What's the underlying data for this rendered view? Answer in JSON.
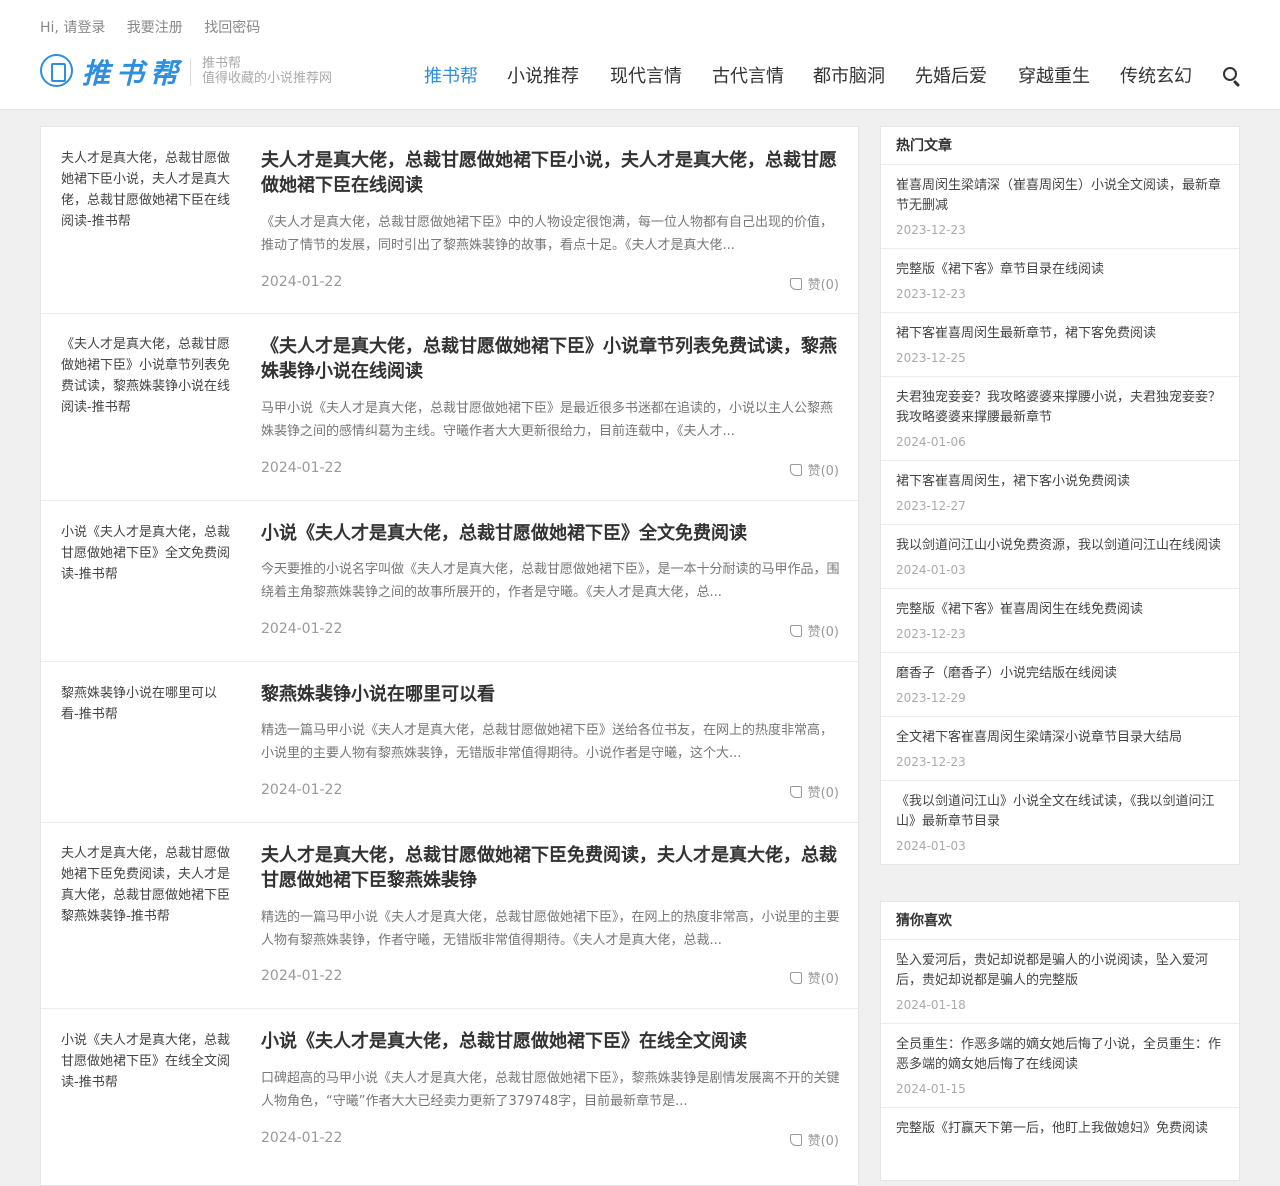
{
  "header": {
    "toplinks": [
      "Hi, 请登录",
      "我要注册",
      "找回密码"
    ],
    "logo_text": "推书帮",
    "logo_sub1": "推书帮",
    "logo_sub2": "值得收藏的小说推荐网",
    "nav": [
      "推书帮",
      "小说推荐",
      "现代言情",
      "古代言情",
      "都市脑洞",
      "先婚后爱",
      "穿越重生",
      "传统玄幻"
    ],
    "active_nav": "推书帮"
  },
  "posts": [
    {
      "thumb": "夫人才是真大佬，总裁甘愿做她裙下臣小说，夫人才是真大佬，总裁甘愿做她裙下臣在线阅读-推书帮",
      "title": "夫人才是真大佬，总裁甘愿做她裙下臣小说，夫人才是真大佬，总裁甘愿做她裙下臣在线阅读",
      "excerpt": "《夫人才是真大佬，总裁甘愿做她裙下臣》中的人物设定很饱满，每一位人物都有自己出现的价值，推动了情节的发展，同时引出了黎燕姝裴铮的故事，看点十足。《夫人才是真大佬...",
      "date": "2024-01-22",
      "like": "赞(0)"
    },
    {
      "thumb": "《夫人才是真大佬，总裁甘愿做她裙下臣》小说章节列表免费试读，黎燕姝裴铮小说在线阅读-推书帮",
      "title": "《夫人才是真大佬，总裁甘愿做她裙下臣》小说章节列表免费试读，黎燕姝裴铮小说在线阅读",
      "excerpt": "马甲小说《夫人才是真大佬，总裁甘愿做她裙下臣》是最近很多书迷都在追读的，小说以主人公黎燕姝裴铮之间的感情纠葛为主线。守曦作者大大更新很给力，目前连载中，《夫人才...",
      "date": "2024-01-22",
      "like": "赞(0)"
    },
    {
      "thumb": "小说《夫人才是真大佬，总裁甘愿做她裙下臣》全文免费阅读-推书帮",
      "title": "小说《夫人才是真大佬，总裁甘愿做她裙下臣》全文免费阅读",
      "excerpt": "今天要推的小说名字叫做《夫人才是真大佬，总裁甘愿做她裙下臣》，是一本十分耐读的马甲作品，围绕着主角黎燕姝裴铮之间的故事所展开的，作者是守曦。《夫人才是真大佬，总...",
      "date": "2024-01-22",
      "like": "赞(0)"
    },
    {
      "thumb": "黎燕姝裴铮小说在哪里可以看-推书帮",
      "title": "黎燕姝裴铮小说在哪里可以看",
      "excerpt": "精选一篇马甲小说《夫人才是真大佬，总裁甘愿做她裙下臣》送给各位书友，在网上的热度非常高，小说里的主要人物有黎燕姝裴铮，无错版非常值得期待。小说作者是守曦，这个大...",
      "date": "2024-01-22",
      "like": "赞(0)"
    },
    {
      "thumb": "夫人才是真大佬，总裁甘愿做她裙下臣免费阅读，夫人才是真大佬，总裁甘愿做她裙下臣黎燕姝裴铮-推书帮",
      "title": "夫人才是真大佬，总裁甘愿做她裙下臣免费阅读，夫人才是真大佬，总裁甘愿做她裙下臣黎燕姝裴铮",
      "excerpt": "精选的一篇马甲小说《夫人才是真大佬，总裁甘愿做她裙下臣》，在网上的热度非常高，小说里的主要人物有黎燕姝裴铮，作者守曦，无错版非常值得期待。《夫人才是真大佬，总裁...",
      "date": "2024-01-22",
      "like": "赞(0)"
    },
    {
      "thumb": "小说《夫人才是真大佬，总裁甘愿做她裙下臣》在线全文阅读-推书帮",
      "title": "小说《夫人才是真大佬，总裁甘愿做她裙下臣》在线全文阅读",
      "excerpt": "口碑超高的马甲小说《夫人才是真大佬，总裁甘愿做她裙下臣》，黎燕姝裴铮是剧情发展离不开的关键人物角色，“守曦”作者大大已经卖力更新了379748字，目前最新章节是...",
      "date": "2024-01-22",
      "like": "赞(0)"
    }
  ],
  "hot": {
    "title": "热门文章",
    "items": [
      {
        "text": "崔喜周闵生梁靖深（崔喜周闵生）小说全文阅读，最新章节无删减",
        "date": "2023-12-23"
      },
      {
        "text": "完整版《裙下客》章节目录在线阅读",
        "date": "2023-12-23"
      },
      {
        "text": "裙下客崔喜周闵生最新章节，裙下客免费阅读",
        "date": "2023-12-25"
      },
      {
        "text": "夫君独宠妾妾？我攻略婆婆来撑腰小说，夫君独宠妾妾？我攻略婆婆来撑腰最新章节",
        "date": "2024-01-06"
      },
      {
        "text": "裙下客崔喜周闵生，裙下客小说免费阅读",
        "date": "2023-12-27"
      },
      {
        "text": "我以剑道问江山小说免费资源，我以剑道问江山在线阅读",
        "date": "2024-01-03"
      },
      {
        "text": "完整版《裙下客》崔喜周闵生在线免费阅读",
        "date": "2023-12-23"
      },
      {
        "text": "磨香子（磨香子）小说完结版在线阅读",
        "date": "2023-12-29"
      },
      {
        "text": "全文裙下客崔喜周闵生梁靖深小说章节目录大结局",
        "date": "2023-12-23"
      },
      {
        "text": "《我以剑道问江山》小说全文在线试读，《我以剑道问江山》最新章节目录",
        "date": "2024-01-03"
      }
    ]
  },
  "guess": {
    "title": "猜你喜欢",
    "items": [
      {
        "text": "坠入爱河后，贵妃却说都是骗人的小说阅读，坠入爱河后，贵妃却说都是骗人的完整版",
        "date": "2024-01-18"
      },
      {
        "text": "全员重生：作恶多端的嫡女她后悔了小说，全员重生：作恶多端的嫡女她后悔了在线阅读",
        "date": "2024-01-15"
      },
      {
        "text": "完整版《打赢天下第一后，他盯上我做媳妇》免费阅读",
        "date": ""
      }
    ]
  }
}
